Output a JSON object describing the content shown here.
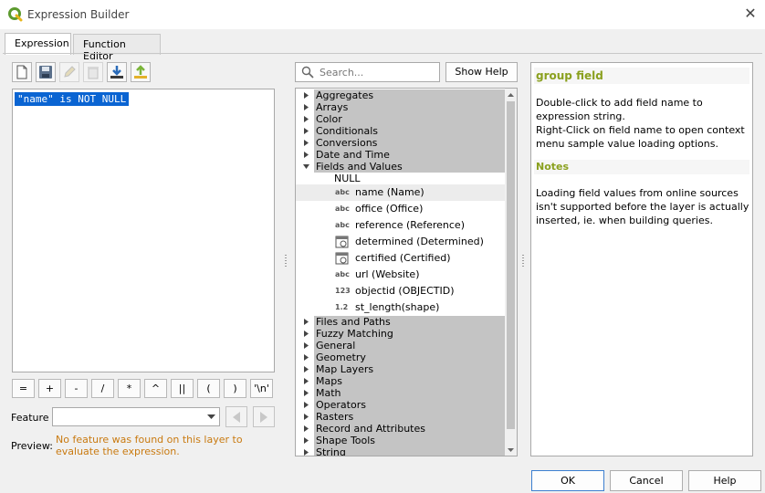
{
  "window": {
    "title": "Expression Builder",
    "close_glyph": "✕"
  },
  "tabs": [
    {
      "label": "Expression",
      "active": true
    },
    {
      "label": "Function Editor",
      "active": false
    }
  ],
  "toolbar": {
    "buttons": [
      {
        "icon": "new-file-icon",
        "enabled": true
      },
      {
        "icon": "save-icon",
        "enabled": true
      },
      {
        "icon": "edit-icon",
        "enabled": false
      },
      {
        "icon": "delete-icon",
        "enabled": false
      },
      {
        "icon": "import-icon",
        "enabled": true
      },
      {
        "icon": "export-icon",
        "enabled": true
      }
    ]
  },
  "editor": {
    "expression": "\"name\" is NOT NULL",
    "selection_color": "#0a64d2"
  },
  "operators": [
    "=",
    "+",
    "-",
    "/",
    "*",
    "^",
    "||",
    "(",
    ")",
    "'\\n'"
  ],
  "feature": {
    "label": "Feature",
    "value": ""
  },
  "preview": {
    "label": "Preview:",
    "message": "No feature was found on this layer to evaluate the expression.",
    "color": "#c97a10"
  },
  "search": {
    "placeholder": "Search...",
    "value": ""
  },
  "show_help_label": "Show Help",
  "tree": {
    "groups_before": [
      "Aggregates",
      "Arrays",
      "Color",
      "Conditionals",
      "Conversions",
      "Date and Time"
    ],
    "expanded_group": "Fields and Values",
    "null_item": "NULL",
    "fields": [
      {
        "type": "abc",
        "label": "name (Name)",
        "selected": true
      },
      {
        "type": "abc",
        "label": "office (Office)"
      },
      {
        "type": "abc",
        "label": "reference (Reference)"
      },
      {
        "type": "calendar",
        "label": "determined (Determined)"
      },
      {
        "type": "calendar",
        "label": "certified (Certified)"
      },
      {
        "type": "abc",
        "label": "url (Website)"
      },
      {
        "type": "123",
        "label": "objectid (OBJECTID)"
      },
      {
        "type": "1.2",
        "label": "st_length(shape)"
      }
    ],
    "groups_after": [
      "Files and Paths",
      "Fuzzy Matching",
      "General",
      "Geometry",
      "Map Layers",
      "Maps",
      "Math",
      "Operators",
      "Rasters",
      "Record and Attributes",
      "Shape Tools",
      "String"
    ]
  },
  "help": {
    "title": "group field",
    "line1": "Double-click to add field name to expression string.",
    "line2": "Right-Click on field name to open context menu sample value loading options.",
    "notes_title": "Notes",
    "notes": "Loading field values from online sources isn't supported before the layer is actually inserted, ie. when building queries.",
    "accent": "#8aa01e"
  },
  "footer": {
    "ok": "OK",
    "cancel": "Cancel",
    "help": "Help"
  }
}
